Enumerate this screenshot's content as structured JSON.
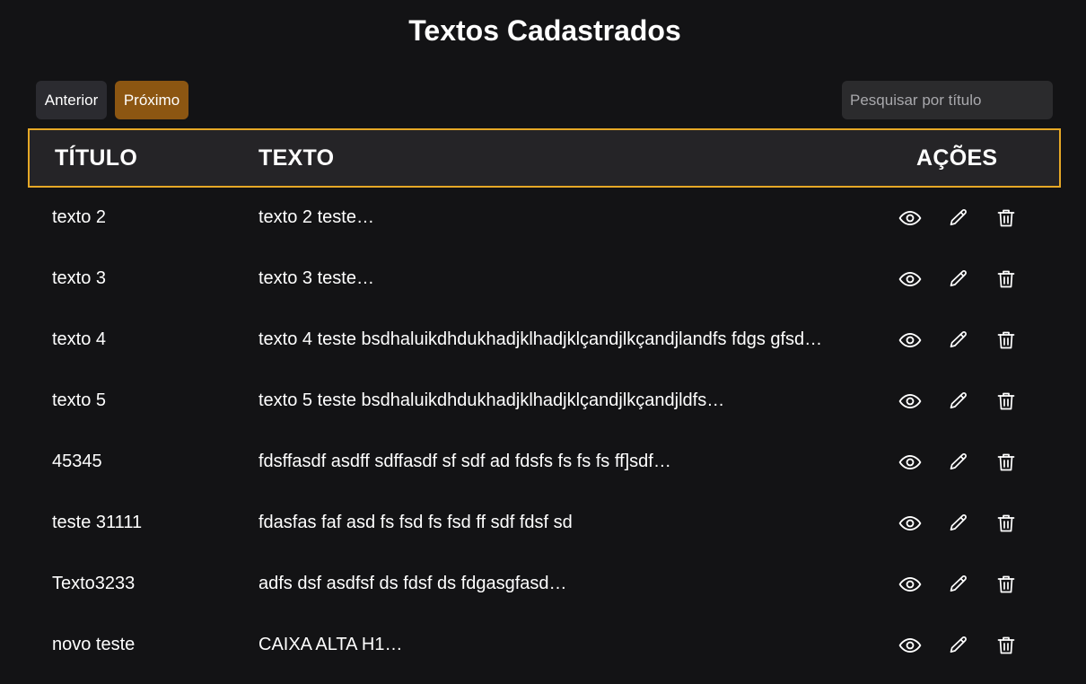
{
  "header": {
    "title": "Textos Cadastrados"
  },
  "toolbar": {
    "prev_label": "Anterior",
    "next_label": "Próximo",
    "search_placeholder": "Pesquisar por título",
    "search_value": ""
  },
  "colors": {
    "background": "#131315",
    "header_border": "#e6a826",
    "next_button": "#8c5612",
    "prev_button": "#2b2b30"
  },
  "table": {
    "columns": [
      "TÍTULO",
      "TEXTO",
      "AÇÕES"
    ],
    "action_icons": [
      "eye-icon",
      "pencil-icon",
      "trash-icon"
    ],
    "rows": [
      {
        "title": "texto 2",
        "text": "texto 2 teste…"
      },
      {
        "title": "texto 3",
        "text": "texto 3 teste…"
      },
      {
        "title": "texto 4",
        "text": "texto 4 teste bsdhaluikdhdukhadjklhadjklçandjlkçandjlandfs fdgs gfsd…"
      },
      {
        "title": "texto 5",
        "text": "texto 5 teste bsdhaluikdhdukhadjklhadjklçandjlkçandjldfs…"
      },
      {
        "title": "45345",
        "text": "fdsffasdf asdff sdffasdf sf sdf ad fdsfs fs fs fs ff]sdf…"
      },
      {
        "title": "teste 31111",
        "text": "fdasfas faf asd fs fsd fs fsd ff sdf fdsf sd"
      },
      {
        "title": "Texto3233",
        "text": "adfs dsf asdfsf ds fdsf ds fdgasgfasd…"
      },
      {
        "title": "novo teste",
        "text": "CAIXA ALTA H1…"
      }
    ]
  }
}
